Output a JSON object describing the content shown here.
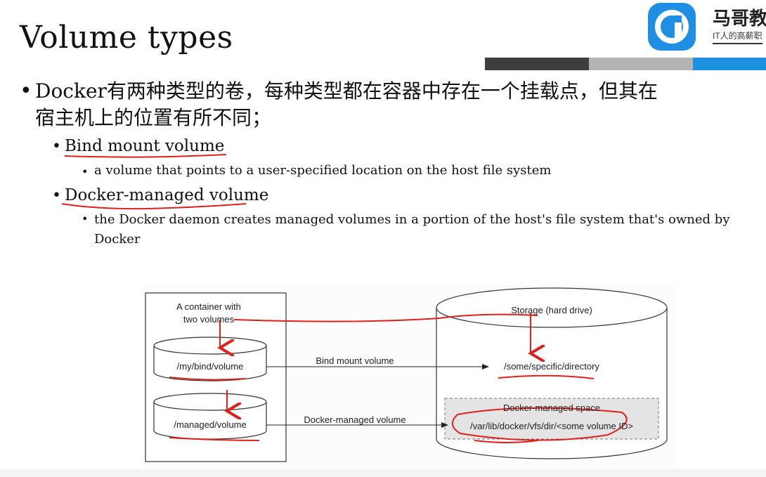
{
  "slide": {
    "title": "Volume types",
    "bullet_main_line1": "Docker有两种类型的卷，每种类型都在容器中存在一个挂载点，但其在",
    "bullet_main_line2": "宿主机上的位置有所不同；",
    "sub1": "Bind mount volume",
    "sub1_detail": "a volume that points to a user-specified location on the host file system",
    "sub2": "Docker-managed volume",
    "sub2_detail": "the Docker daemon creates managed volumes in a portion of the host's file system that's owned by Docker"
  },
  "logo": {
    "name": "马哥教",
    "tagline": "IT人的高薪职"
  },
  "diagram": {
    "container_label_line1": "A container with",
    "container_label_line2": "two volumes",
    "vol1": "/my/bind/volume",
    "vol2": "/managed/volume",
    "arrow1_label": "Bind mount volume",
    "arrow2_label": "Docker-managed volume",
    "storage_label": "Storage (hard drive)",
    "host_dir": "/some/specific/directory",
    "managed_space_label": "Docker-managed space",
    "managed_path": "/var/lib/docker/vfs/dir/<some volume ID>"
  },
  "colors": {
    "annotation": "#e0201b",
    "bar_dark": "#3d3d3d",
    "bar_gray": "#b3b3b3",
    "bar_blue": "#1e90e0",
    "logo_blue": "#1e8fe3"
  }
}
